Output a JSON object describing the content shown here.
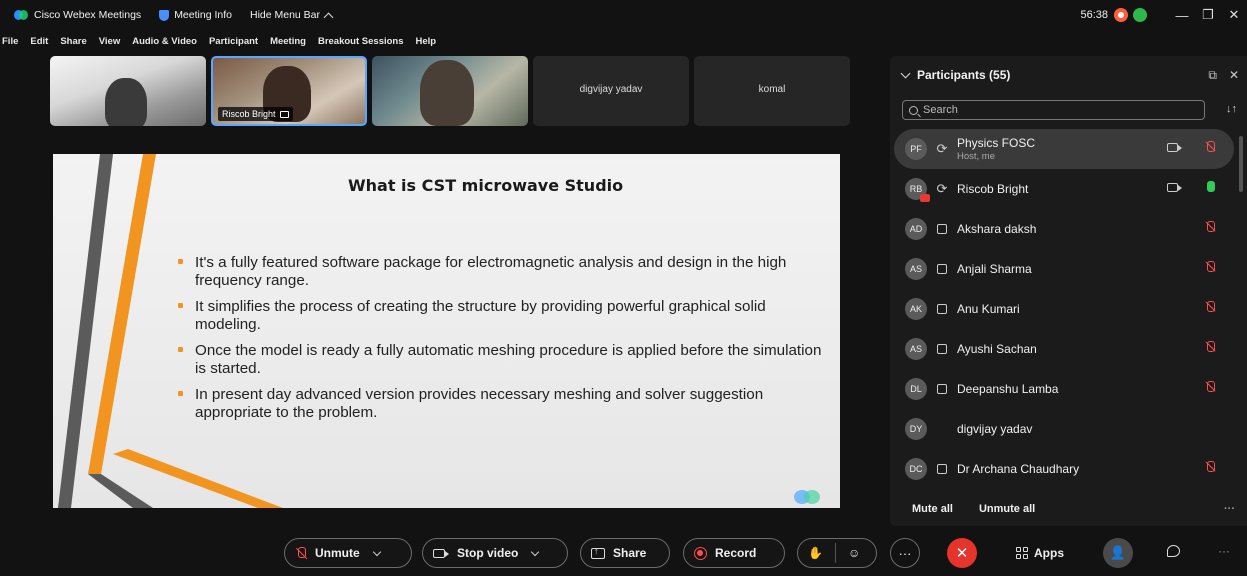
{
  "titlebar": {
    "app_title": "Cisco Webex Meetings",
    "meeting_info": "Meeting Info",
    "hide_menu_bar": "Hide Menu Bar",
    "timer": "56:38",
    "window_buttons": [
      "—",
      "❐",
      "✕"
    ]
  },
  "menubar": {
    "items": [
      "File",
      "Edit",
      "Share",
      "View",
      "Audio & Video",
      "Participant",
      "Meeting",
      "Breakout Sessions",
      "Help"
    ]
  },
  "video_strip": {
    "active_label": "Riscob Bright",
    "tiles": [
      {
        "name": "digvijay yadav"
      },
      {
        "name": "komal"
      }
    ]
  },
  "slide": {
    "title": "What is CST microwave Studio",
    "bullets": [
      "It's a fully featured software package for electromagnetic analysis and design in the high frequency range.",
      "It simplifies the process of creating the structure by providing powerful graphical solid modeling.",
      "Once the model is ready a fully automatic meshing procedure is applied before the simulation is started.",
      "In present day advanced version provides necessary meshing and solver suggestion appropriate to the problem."
    ],
    "accent_colors": {
      "orange": "#f29520",
      "dark": "#5b5b5b"
    }
  },
  "participants": {
    "header": "Participants (55)",
    "search_placeholder": "Search",
    "list": [
      {
        "initials": "PF",
        "name": "Physics FOSC",
        "sub": "Host, me",
        "device": "sync",
        "camera": true,
        "mic": "muted"
      },
      {
        "initials": "RB",
        "name": "Riscob Bright",
        "sub": "",
        "device": "sync",
        "camera": true,
        "mic": "live"
      },
      {
        "initials": "AD",
        "name": "Akshara daksh",
        "sub": "",
        "device": "pc",
        "camera": false,
        "mic": "muted"
      },
      {
        "initials": "AS",
        "name": "Anjali Sharma",
        "sub": "",
        "device": "pc",
        "camera": false,
        "mic": "muted"
      },
      {
        "initials": "AK",
        "name": "Anu Kumari",
        "sub": "",
        "device": "pc",
        "camera": false,
        "mic": "muted"
      },
      {
        "initials": "AS",
        "name": "Ayushi Sachan",
        "sub": "",
        "device": "pc",
        "camera": false,
        "mic": "muted"
      },
      {
        "initials": "DL",
        "name": "Deepanshu Lamba",
        "sub": "",
        "device": "pc",
        "camera": false,
        "mic": "muted"
      },
      {
        "initials": "DY",
        "name": "digvijay yadav",
        "sub": "",
        "device": "none",
        "camera": false,
        "mic": "none"
      },
      {
        "initials": "DC",
        "name": "Dr Archana Chaudhary",
        "sub": "",
        "device": "pc",
        "camera": false,
        "mic": "muted"
      }
    ],
    "mute_all": "Mute all",
    "unmute_all": "Unmute all"
  },
  "toolbar": {
    "unmute": "Unmute",
    "stop_video": "Stop video",
    "share": "Share",
    "record": "Record",
    "apps": "Apps",
    "end_color": "#e5342c"
  }
}
